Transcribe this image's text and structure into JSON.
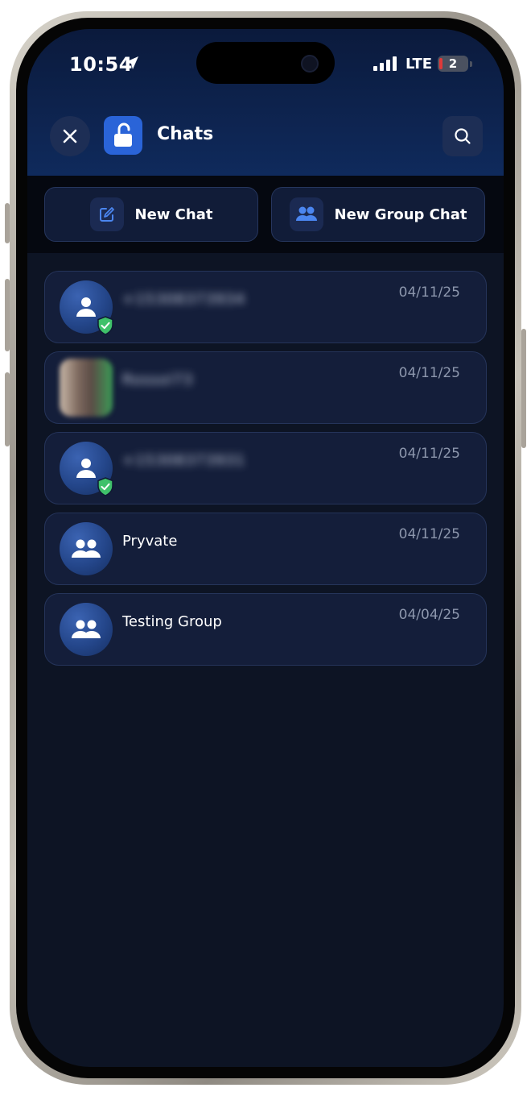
{
  "status_bar": {
    "time": "10:54",
    "network": "LTE",
    "battery": "2"
  },
  "header": {
    "title": "Chats"
  },
  "actions": {
    "new_chat": "New Chat",
    "new_group_chat": "New Group Chat"
  },
  "chats": [
    {
      "name": "+15308373934",
      "date": "04/11/25",
      "avatar": "person-icon",
      "verified": true,
      "name_redacted": true
    },
    {
      "name": "Rossol73",
      "date": "04/11/25",
      "avatar": "photo",
      "verified": false,
      "name_redacted": true
    },
    {
      "name": "+15308373931",
      "date": "04/11/25",
      "avatar": "person-icon",
      "verified": true,
      "name_redacted": true
    },
    {
      "name": "Pryvate",
      "date": "04/11/25",
      "avatar": "group-icon",
      "verified": false,
      "name_redacted": false
    },
    {
      "name": "Testing Group",
      "date": "04/04/25",
      "avatar": "group-icon",
      "verified": false,
      "name_redacted": false
    }
  ],
  "colors": {
    "accent": "#2a64d8",
    "background": "#0d1424",
    "card": "#141e3a",
    "verified": "#3fc16a"
  }
}
